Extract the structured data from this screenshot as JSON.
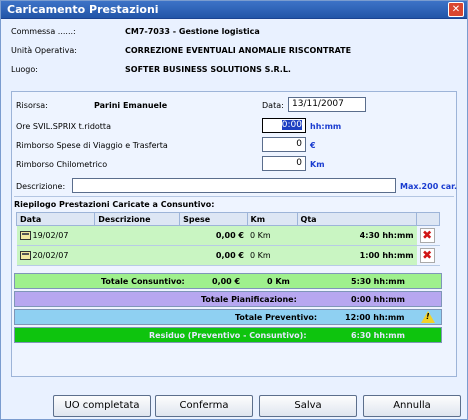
{
  "window": {
    "title": "Caricamento Prestazioni"
  },
  "header": {
    "commessa_label": "Commessa ......:",
    "commessa_value": "CM7-7033 - Gestione logistica",
    "unita_label": "Unità Operativa:",
    "unita_value": "CORREZIONE EVENTUALI ANOMALIE RISCONTRATE",
    "luogo_label": "Luogo:",
    "luogo_value": "SOFTER BUSINESS SOLUTIONS S.R.L."
  },
  "form": {
    "risorsa_label": "Risorsa:",
    "risorsa_value": "Parini Emanuele",
    "data_label": "Data:",
    "data_value": "13/11/2007",
    "ore_label": "Ore SVIL.SPRIX t.ridotta",
    "ore_value": "0:00",
    "ore_unit": "hh:mm",
    "rimborso_viaggio_label": "Rimborso Spese di Viaggio e Trasferta",
    "rimborso_viaggio_value": "0",
    "rimborso_viaggio_unit": "€",
    "rimborso_km_label": "Rimborso Chilometrico",
    "rimborso_km_value": "0",
    "rimborso_km_unit": "Km",
    "descrizione_label": "Descrizione:",
    "descrizione_value": "",
    "descrizione_hint": "Max.200 car."
  },
  "riepilogo": {
    "title": "Riepilogo Prestazioni Caricate a Consuntivo:",
    "columns": [
      "Data",
      "Descrizione",
      "Spese",
      "Km",
      "Qta"
    ],
    "rows": [
      {
        "data": "19/02/07",
        "descrizione": "",
        "spese": "0,00 €",
        "km": "0 Km",
        "qta": "4:30 hh:mm"
      },
      {
        "data": "20/02/07",
        "descrizione": "",
        "spese": "0,00 €",
        "km": "0 Km",
        "qta": "1:00 hh:mm"
      }
    ],
    "totale_consuntivo": {
      "label": "Totale Consuntivo:",
      "spese": "0,00 €",
      "km": "0 Km",
      "qta": "5:30 hh:mm"
    },
    "totale_pianificazione": {
      "label": "Totale Pianificazione:",
      "qta": "0:00 hh:mm"
    },
    "totale_preventivo": {
      "label": "Totale Preventivo:",
      "qta": "12:00 hh:mm"
    },
    "residuo": {
      "label": "Residuo (Preventivo - Consuntivo):",
      "qta": "6:30 hh:mm"
    }
  },
  "buttons": {
    "uo_completata": "UO completata",
    "conferma": "Conferma",
    "salva": "Salva",
    "annulla": "Annulla"
  },
  "colors": {
    "titlebar": "#2d62b8",
    "row_green": "#c9f5c2",
    "totale_consuntivo": "#9ff08d",
    "totale_pianificazione": "#b7a7f0",
    "totale_preventivo": "#8fd0f2",
    "residuo": "#0ec40e"
  },
  "icons": [
    "calendar-icon",
    "delete-icon",
    "warning-icon",
    "close-icon"
  ]
}
